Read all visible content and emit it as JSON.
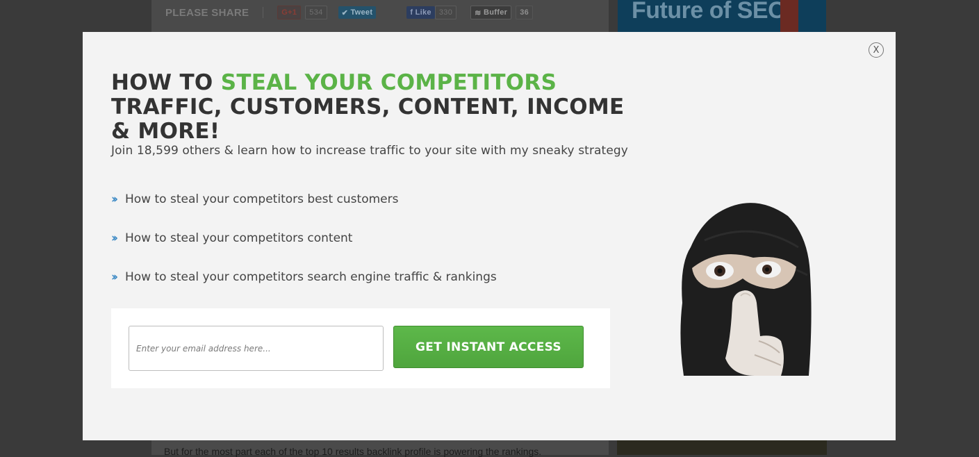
{
  "background_page": {
    "share_label": "PLEASE SHARE",
    "gplus_label": "G+1",
    "gplus_count": "534",
    "tweet_label": "Tweet",
    "like_label": "Like",
    "like_count": "330",
    "buffer_label": "Buffer",
    "buffer_count": "36",
    "sidebar_ad_text": "Future of SEO",
    "article_text": "But for the most part each of the top 10 results backlink profile is powering the rankings."
  },
  "modal": {
    "close_label": "X",
    "headline": {
      "part1": "HOW TO ",
      "highlight": "STEAL YOUR COMPETITORS",
      "part2": " TRAFFIC, CUSTOMERS, CONTENT, INCOME & MORE!"
    },
    "subhead": "Join 18,599 others & learn how to increase traffic to your site with my sneaky strategy",
    "bullets": [
      "How to steal your competitors best customers",
      "How to steal your competitors content",
      "How to steal your competitors search engine traffic & rankings"
    ],
    "bullet_icon": "double-chevron-right-icon",
    "email_placeholder": "Enter your email address here...",
    "cta_label": "GET INSTANT ACCESS"
  },
  "colors": {
    "highlight_green": "#5bb347",
    "button_green": "#56ad43",
    "bullet_blue": "#3a88c4",
    "overlay": "#3a3a3a"
  }
}
